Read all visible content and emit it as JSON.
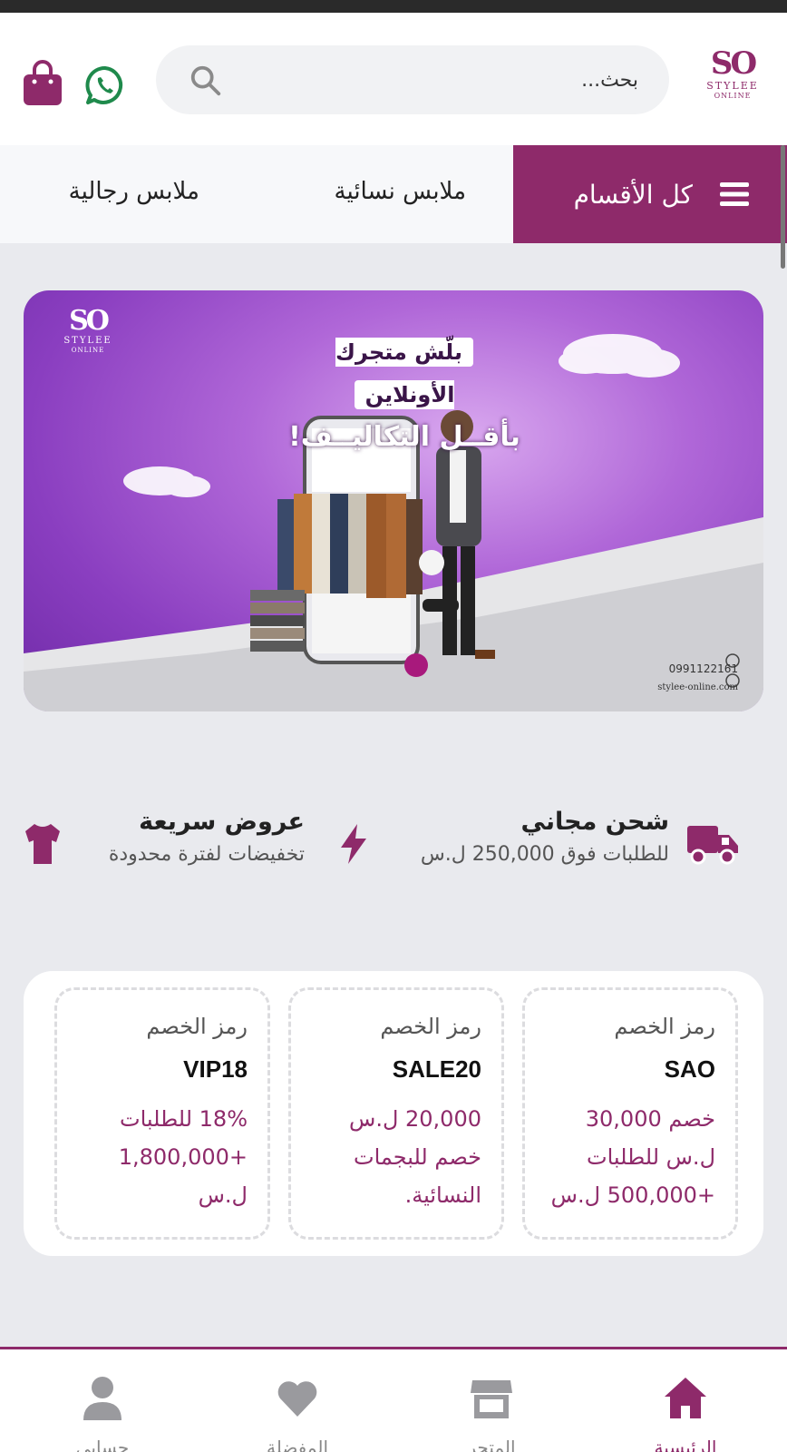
{
  "header": {
    "logo_mono": "SO",
    "logo_brand": "STYLEE",
    "logo_sub": "ONLINE",
    "search_placeholder": "بحث..."
  },
  "categories": {
    "all_label": "كل الأقسام",
    "women_label": "ملابس نسائية",
    "men_label": "ملابس رجالية"
  },
  "banner": {
    "logo_mono": "SO",
    "logo_brand": "STYLEE",
    "logo_sub": "ONLINE",
    "headline_line1": "بلّش متجرك الأونلاين",
    "headline_line2": "بأقــل التكاليــف!",
    "phone": "0991122161",
    "website": "stylee-online.com"
  },
  "features": [
    {
      "title": "شحن مجاني",
      "subtitle": "للطلبات فوق 250,000 ل.س",
      "icon": "truck-icon"
    },
    {
      "title": "عروض سريعة",
      "subtitle": "تخفيضات لفترة محدودة",
      "icon": "bolt-icon"
    }
  ],
  "coupons": [
    {
      "label": "رمز الخصم",
      "code": "SAO",
      "desc_lines": [
        "خصم 30,000",
        "ل.س للطلبات",
        "+500,000 ل.س"
      ]
    },
    {
      "label": "رمز الخصم",
      "code": "SALE20",
      "desc_lines": [
        "20,000 ل.س",
        "خصم للبجمات",
        "النسائية."
      ]
    },
    {
      "label": "رمز الخصم",
      "code": "VIP18",
      "desc_lines": [
        "18% للطلبات",
        "+1,800,000",
        "ل.س"
      ]
    }
  ],
  "bottom_nav": [
    {
      "label": "الرئيسية",
      "icon": "home-icon",
      "active": true
    },
    {
      "label": "المتجر",
      "icon": "store-icon",
      "active": false
    },
    {
      "label": "المفضلة",
      "icon": "heart-icon",
      "active": false
    },
    {
      "label": "حسابي",
      "icon": "user-icon",
      "active": false
    }
  ],
  "colors": {
    "brand": "#8e2a6a",
    "whatsapp": "#1f8a4c",
    "background": "#e9eaee"
  }
}
